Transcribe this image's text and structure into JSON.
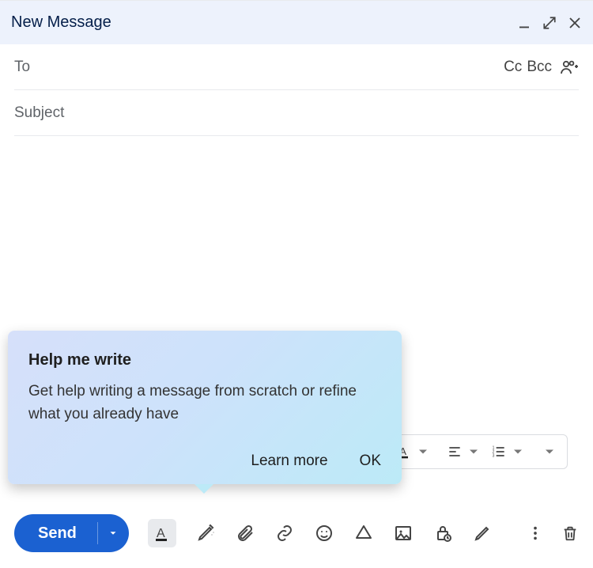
{
  "header": {
    "title": "New Message"
  },
  "fields": {
    "to_label": "To",
    "cc_label": "Cc",
    "bcc_label": "Bcc",
    "subject_placeholder": "Subject"
  },
  "tooltip": {
    "title": "Help me write",
    "body": "Get help writing a message from scratch or refine what you already have",
    "learn_more": "Learn more",
    "ok": "OK"
  },
  "send_label": "Send",
  "format_text_glyph": "A"
}
